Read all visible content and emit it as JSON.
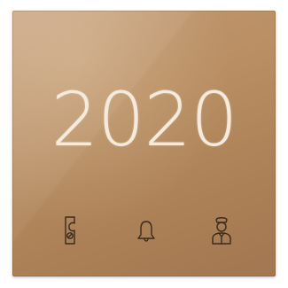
{
  "panel": {
    "room_number": "2020",
    "colors": {
      "glass": "#b98f63",
      "glyph": "#f4ebde"
    },
    "icons": [
      {
        "name": "do-not-disturb-door-hanger-icon"
      },
      {
        "name": "doorbell-icon"
      },
      {
        "name": "room-service-staff-icon"
      }
    ]
  }
}
